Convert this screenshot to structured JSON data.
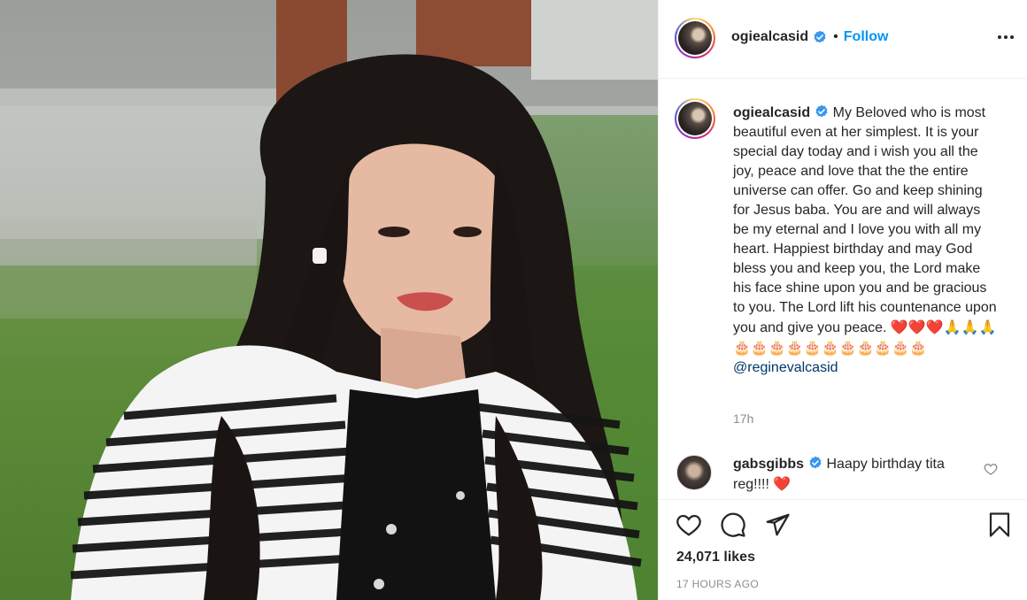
{
  "post": {
    "author": {
      "username": "ogiealcasid",
      "verified": true,
      "follow_label": "Follow",
      "separator": "•"
    },
    "caption": {
      "text": "My Beloved who is most beautiful even at her simplest. It is your special day today and i wish you all the joy, peace and love that the the entire universe can offer. Go and keep shining for Jesus baba. You are and will always be my eternal and I love you with all my heart. Happiest birthday and may God bless you and keep you, the Lord make his face shine upon you and be gracious to you. The Lord lift his countenance upon you and give you peace. ",
      "emojis": "❤️❤️❤️🙏🙏🙏🎂🎂🎂🎂🎂🎂🎂🎂🎂🎂🎂",
      "mention": "@reginevalcasid",
      "time": "17h"
    },
    "comments": [
      {
        "username": "gabsgibbs",
        "verified": true,
        "text": "Haapy birthday tita reg!!!! ",
        "emoji": "❤️"
      }
    ],
    "likes": "24,071 likes",
    "posted": "17 HOURS AGO"
  },
  "colors": {
    "accent": "#0095f6",
    "text": "#262626",
    "muted": "#8e8e8e",
    "mention": "#00376b",
    "verified": "#3897f0",
    "heart": "#e0245e"
  },
  "icons": {
    "more": "more-options-icon",
    "verified": "verified-badge-icon",
    "like": "heart-icon",
    "comment": "comment-bubble-icon",
    "share": "paper-plane-icon",
    "save": "bookmark-icon"
  }
}
